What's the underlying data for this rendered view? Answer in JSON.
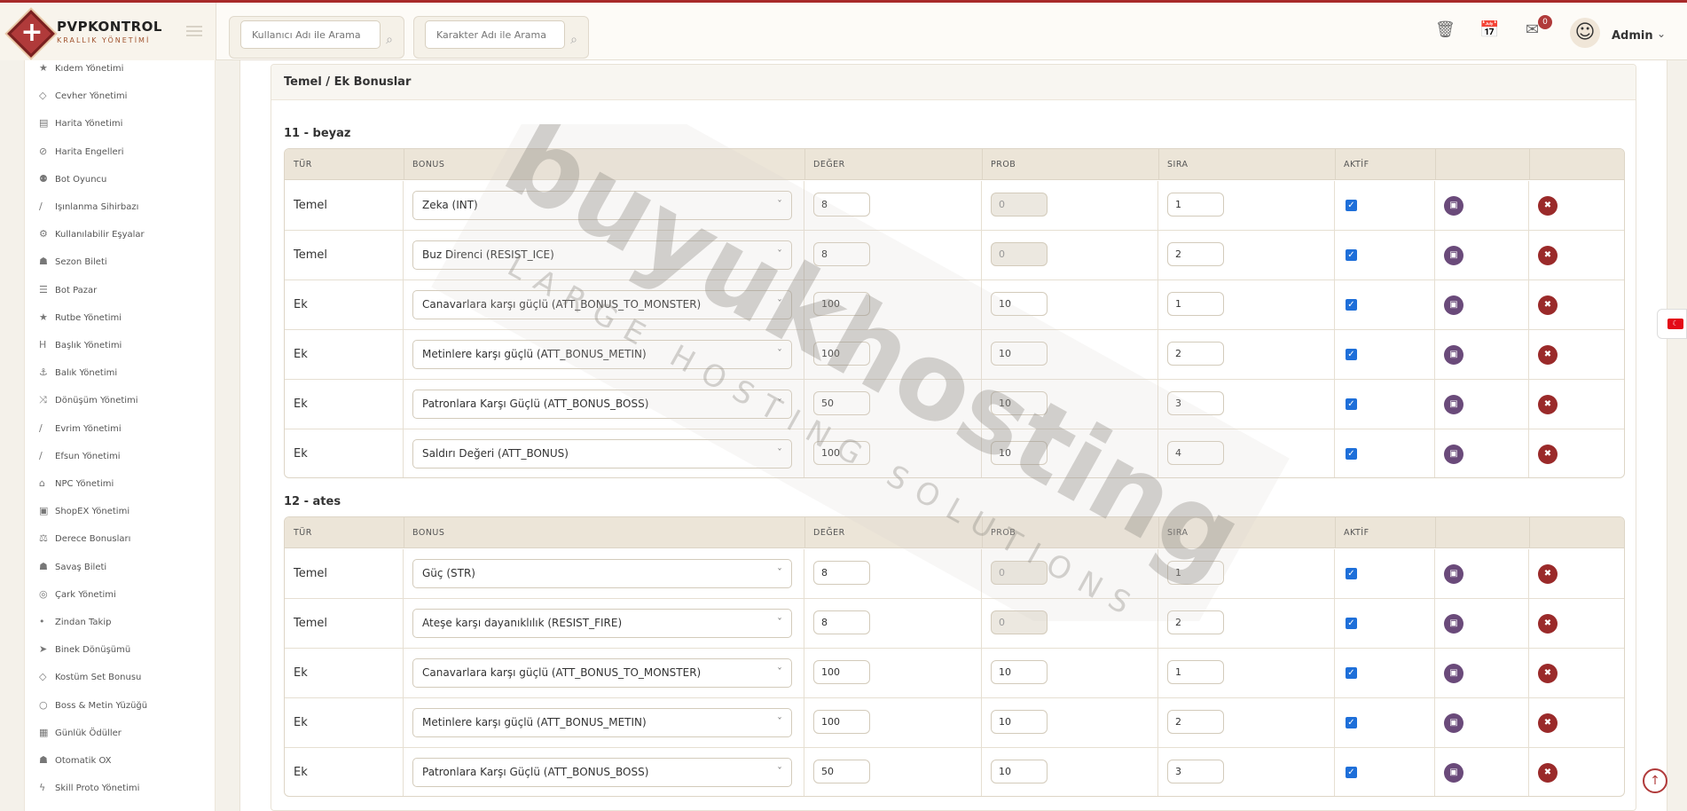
{
  "brand": {
    "name": "PVPKONTROL",
    "subtitle": "KRALLIK YÖNETİMİ"
  },
  "search": {
    "user_placeholder": "Kullanıcı Adı ile Arama",
    "char_placeholder": "Karakter Adı ile Arama"
  },
  "header": {
    "notification_count": "0",
    "user_name": "Admin"
  },
  "sidebar": {
    "items": [
      {
        "label": "Kıdem Yönetimi",
        "icon": "star-icon"
      },
      {
        "label": "Cevher Yönetimi",
        "icon": "gem-icon"
      },
      {
        "label": "Harita Yönetimi",
        "icon": "map-icon"
      },
      {
        "label": "Harita Engelleri",
        "icon": "ban-icon"
      },
      {
        "label": "Bot Oyuncu",
        "icon": "android-icon"
      },
      {
        "label": "Işınlanma Sihirbazı",
        "icon": "wand-icon"
      },
      {
        "label": "Kullanılabilir Eşyalar",
        "icon": "gears-icon"
      },
      {
        "label": "Sezon Bileti",
        "icon": "trophy-icon"
      },
      {
        "label": "Bot Pazar",
        "icon": "cart-icon"
      },
      {
        "label": "Rutbe Yönetimi",
        "icon": "star-icon"
      },
      {
        "label": "Başlık Yönetimi",
        "icon": "heading-icon"
      },
      {
        "label": "Balık Yönetimi",
        "icon": "anchor-icon"
      },
      {
        "label": "Dönüşüm Yönetimi",
        "icon": "shuffle-icon"
      },
      {
        "label": "Evrim Yönetimi",
        "icon": "wand-icon"
      },
      {
        "label": "Efsun Yönetimi",
        "icon": "wand-icon"
      },
      {
        "label": "NPC Yönetimi",
        "icon": "bank-icon"
      },
      {
        "label": "ShopEX Yönetimi",
        "icon": "store-icon"
      },
      {
        "label": "Derece Bonusları",
        "icon": "balance-icon"
      },
      {
        "label": "Savaş Bileti",
        "icon": "trophy-icon"
      },
      {
        "label": "Çark Yönetimi",
        "icon": "globe-icon"
      },
      {
        "label": "Zindan Takip",
        "icon": "pin-icon"
      },
      {
        "label": "Binek Dönüşümü",
        "icon": "rocket-icon"
      },
      {
        "label": "Kostüm Set Bonusu",
        "icon": "gem-icon"
      },
      {
        "label": "Boss & Metin Yüzüğü",
        "icon": "circle-icon"
      },
      {
        "label": "Günlük Ödüller",
        "icon": "calendar-icon"
      },
      {
        "label": "Otomatik OX",
        "icon": "trophy-icon"
      },
      {
        "label": "Skill Proto Yönetimi",
        "icon": "bolt-icon"
      }
    ]
  },
  "card": {
    "title": "Temel / Ek Bonuslar"
  },
  "columns": [
    "TÜR",
    "BONUS",
    "DEĞER",
    "PROB",
    "SIRA",
    "AKTİF"
  ],
  "groups": [
    {
      "title": "11 - beyaz",
      "rows": [
        {
          "type": "Temel",
          "bonus": "Zeka (INT)",
          "value": "8",
          "prob": "0",
          "prob_disabled": true,
          "order": "1"
        },
        {
          "type": "Temel",
          "bonus": "Buz Direnci (RESIST_ICE)",
          "value": "8",
          "prob": "0",
          "prob_disabled": true,
          "order": "2"
        },
        {
          "type": "Ek",
          "bonus": "Canavarlara karşı güçlü (ATT_BONUS_TO_MONSTER)",
          "value": "100",
          "prob": "10",
          "prob_disabled": false,
          "order": "1"
        },
        {
          "type": "Ek",
          "bonus": "Metinlere karşı güçlü (ATT_BONUS_METIN)",
          "value": "100",
          "prob": "10",
          "prob_disabled": false,
          "order": "2"
        },
        {
          "type": "Ek",
          "bonus": "Patronlara Karşı Güçlü (ATT_BONUS_BOSS)",
          "value": "50",
          "prob": "10",
          "prob_disabled": false,
          "order": "3"
        },
        {
          "type": "Ek",
          "bonus": "Saldırı Değeri (ATT_BONUS)",
          "value": "100",
          "prob": "10",
          "prob_disabled": false,
          "order": "4"
        }
      ]
    },
    {
      "title": "12 - ates",
      "rows": [
        {
          "type": "Temel",
          "bonus": "Güç (STR)",
          "value": "8",
          "prob": "0",
          "prob_disabled": true,
          "order": "1"
        },
        {
          "type": "Temel",
          "bonus": "Ateşe karşı dayanıklılık (RESIST_FIRE)",
          "value": "8",
          "prob": "0",
          "prob_disabled": true,
          "order": "2"
        },
        {
          "type": "Ek",
          "bonus": "Canavarlara karşı güçlü (ATT_BONUS_TO_MONSTER)",
          "value": "100",
          "prob": "10",
          "prob_disabled": false,
          "order": "1"
        },
        {
          "type": "Ek",
          "bonus": "Metinlere karşı güçlü (ATT_BONUS_METIN)",
          "value": "100",
          "prob": "10",
          "prob_disabled": false,
          "order": "2"
        },
        {
          "type": "Ek",
          "bonus": "Patronlara Karşı Güçlü (ATT_BONUS_BOSS)",
          "value": "50",
          "prob": "10",
          "prob_disabled": false,
          "order": "3"
        }
      ]
    }
  ],
  "watermark": {
    "main": "buyukhosting",
    "sub": "LARGE HOSTING SOLUTIONS"
  }
}
